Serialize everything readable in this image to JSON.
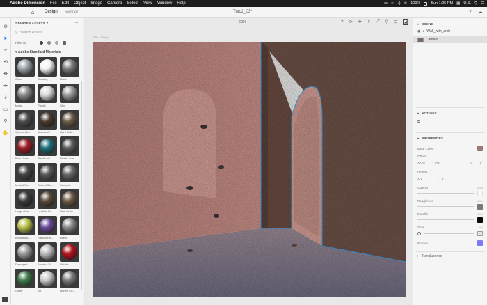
{
  "menubar": {
    "items": [
      "Adobe Dimension",
      "File",
      "Edit",
      "Object",
      "Image",
      "Camera",
      "Select",
      "View",
      "Window",
      "Help"
    ],
    "battery": "100%",
    "time": "Sun 1:25 PM",
    "locale": "U.S."
  },
  "tabs": {
    "design": "Design",
    "render": "Render"
  },
  "document_title": "Tuto2_03*",
  "zoom": "60%",
  "canvas_size": "3000 x 2000 px",
  "assets": {
    "header": "STARTER ASSETS",
    "search_placeholder": "Search Assets...",
    "filter_label": "Filter By",
    "section_title": "Adobe Standard Materials",
    "materials": [
      {
        "name": "Glass",
        "color": "#9aa3a8"
      },
      {
        "name": "Glowing",
        "color": "#f4f4f4"
      },
      {
        "name": "Matte",
        "color": "#7c7c7c"
      },
      {
        "name": "Metal",
        "color": "#8b8b8b"
      },
      {
        "name": "Plastic",
        "color": "#d9d9d9"
      },
      {
        "name": "Wax",
        "color": "#9a9a9a"
      },
      {
        "name": "Spruce Wo...",
        "color": "#4d4d4d"
      },
      {
        "name": "Walnut W...",
        "color": "#4a3a2e"
      },
      {
        "name": "Light Oak...",
        "color": "#6b5a48"
      },
      {
        "name": "Fine Grain...",
        "color": "#9c1d26"
      },
      {
        "name": "Plastic wit...",
        "color": "#1f6f7a"
      },
      {
        "name": "Plastic Can...",
        "color": "#5b5b5b"
      },
      {
        "name": "Melted Sn...",
        "color": "#454545"
      },
      {
        "name": "Striped Ste...",
        "color": "#5a5a5a"
      },
      {
        "name": "Cement",
        "color": "#6a6a6a"
      },
      {
        "name": "Large Grai...",
        "color": "#3b3b3b"
      },
      {
        "name": "Leather Se...",
        "color": "#5a4a3a"
      },
      {
        "name": "Fine Grain...",
        "color": "#6c5a46"
      },
      {
        "name": "Brushed A...",
        "color": "#b9c04a"
      },
      {
        "name": "Rainbow R...",
        "color": "#6a4c9a"
      },
      {
        "name": "Brass",
        "color": "#8a8a8a"
      },
      {
        "name": "Damaged ...",
        "color": "#9a9a9a"
      },
      {
        "name": "Frosted Gl...",
        "color": "#bcbcbc"
      },
      {
        "name": "Gelatin",
        "color": "#b2131e"
      },
      {
        "name": "Glitter",
        "color": "#3f7a4a"
      },
      {
        "name": "Ice",
        "color": "#c9c9c9"
      },
      {
        "name": "Marble Ch...",
        "color": "#7a7a7a"
      }
    ]
  },
  "scene": {
    "title": "SCENE",
    "object_name": "Wall_with_arch",
    "camera_name": "Camera 1"
  },
  "actions": {
    "title": "ACTIONS"
  },
  "properties": {
    "title": "PROPERTIES",
    "base_color_label": "Base Color",
    "base_color": "#9a7b73",
    "offset_label": "Offset",
    "offset_x": "X  0%",
    "offset_y": "Y  0%",
    "rotation": "0°",
    "repeat_label": "Repeat",
    "repeat_x": "X  1",
    "repeat_y": "Y  1",
    "opacity_label": "Opacity",
    "opacity_value": "100%",
    "roughness_label": "Roughness",
    "roughness_value": "100%",
    "metallic_label": "Metallic",
    "metallic_value": "100%",
    "glow_label": "Glow",
    "glow_value": "0%",
    "normal_label": "Normal",
    "normal_color": "#7b7bf5",
    "translucence_label": "Translucence"
  }
}
